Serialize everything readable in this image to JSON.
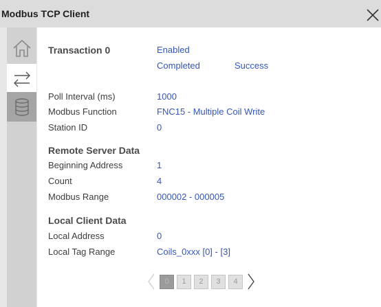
{
  "window": {
    "title": "Modbus TCP Client"
  },
  "sidebar": {
    "items": [
      {
        "name": "home-icon"
      },
      {
        "name": "transfer-arrows-icon"
      },
      {
        "name": "database-icon"
      }
    ]
  },
  "transaction": {
    "label": "Transaction 0",
    "status_enabled": "Enabled",
    "status_completed": "Completed",
    "status_result": "Success"
  },
  "fields": {
    "poll_interval_label": "Poll Interval (ms)",
    "poll_interval_value": "1000",
    "modbus_function_label": "Modbus Function",
    "modbus_function_value": "FNC15 - Multiple Coil Write",
    "station_id_label": "Station ID",
    "station_id_value": "0"
  },
  "remote_server": {
    "heading": "Remote Server Data",
    "beginning_address_label": "Beginning Address",
    "beginning_address_value": "1",
    "count_label": "Count",
    "count_value": "4",
    "modbus_range_label": "Modbus Range",
    "modbus_range_value": "000002 - 000005"
  },
  "local_client": {
    "heading": "Local Client Data",
    "local_address_label": "Local Address",
    "local_address_value": "0",
    "local_tag_range_label": "Local Tag Range",
    "local_tag_range_value": "Coils_0xxx [0] - [3]"
  },
  "pager": {
    "pages": [
      "0",
      "1",
      "2",
      "3",
      "4"
    ],
    "active_page": "0"
  },
  "colors": {
    "value_blue": "#3456b8",
    "title_bar": "#dcdcdc",
    "sidebar": "#d1d1d1"
  }
}
